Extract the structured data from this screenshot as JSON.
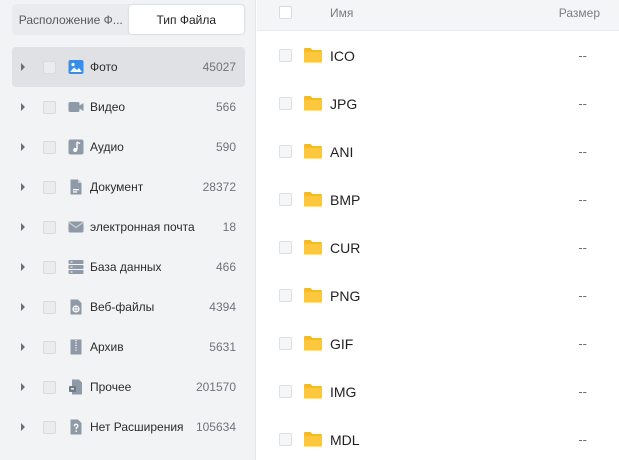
{
  "tabs": {
    "location_label": "Расположение Ф...",
    "filetype_label": "Тип Файла"
  },
  "categories": [
    {
      "label": "Фото",
      "count": "45027",
      "icon": "photo-icon"
    },
    {
      "label": "Видео",
      "count": "566",
      "icon": "video-icon"
    },
    {
      "label": "Аудио",
      "count": "590",
      "icon": "audio-icon"
    },
    {
      "label": "Документ",
      "count": "28372",
      "icon": "document-icon"
    },
    {
      "label": "электронная почта",
      "count": "18",
      "icon": "email-icon"
    },
    {
      "label": "База данных",
      "count": "466",
      "icon": "database-icon"
    },
    {
      "label": "Веб-файлы",
      "count": "4394",
      "icon": "web-files-icon"
    },
    {
      "label": "Архив",
      "count": "5631",
      "icon": "archive-icon"
    },
    {
      "label": "Прочее",
      "count": "201570",
      "icon": "other-icon"
    },
    {
      "label": "Нет Расширения",
      "count": "105634",
      "icon": "no-extension-icon"
    }
  ],
  "table": {
    "col_name": "Имя",
    "col_size": "Размер",
    "rows": [
      {
        "name": "ICO",
        "size": "--"
      },
      {
        "name": "JPG",
        "size": "--"
      },
      {
        "name": "ANI",
        "size": "--"
      },
      {
        "name": "BMP",
        "size": "--"
      },
      {
        "name": "CUR",
        "size": "--"
      },
      {
        "name": "PNG",
        "size": "--"
      },
      {
        "name": "GIF",
        "size": "--"
      },
      {
        "name": "IMG",
        "size": "--"
      },
      {
        "name": "MDL",
        "size": "--"
      }
    ]
  },
  "colors": {
    "accent": "#3a8de6",
    "folder": "#f7b924",
    "icon_gray": "#8f9aa8"
  }
}
